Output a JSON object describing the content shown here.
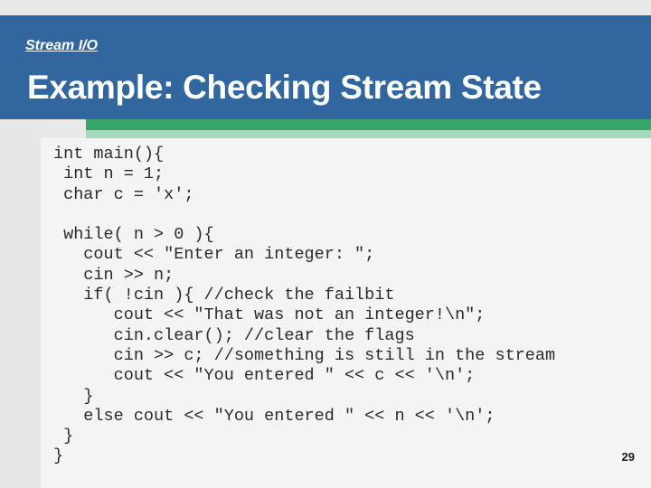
{
  "slide": {
    "kicker": "Stream I/O",
    "title": "Example: Checking Stream State",
    "number": "29",
    "colors": {
      "header_blue": "#31679e",
      "accent_green": "#38a569",
      "accent_green_light": "#a5d9bd",
      "page_background": "#e9e9e9",
      "panel_background": "#f4f4f4",
      "code_text": "#2b2b2b",
      "title_text": "#ffffff"
    }
  },
  "code": {
    "language": "cpp",
    "text": "int main(){\n int n = 1;\n char c = 'x';\n\n while( n > 0 ){\n   cout << \"Enter an integer: \";\n   cin >> n;\n   if( !cin ){ //check the failbit\n      cout << \"That was not an integer!\\n\";\n      cin.clear(); //clear the flags\n      cin >> c; //something is still in the stream\n      cout << \"You entered \" << c << '\\n';\n   }\n   else cout << \"You entered \" << n << '\\n';\n }\n}",
    "lines": [
      "int main(){",
      " int n = 1;",
      " char c = 'x';",
      "",
      " while( n > 0 ){",
      "   cout << \"Enter an integer: \";",
      "   cin >> n;",
      "   if( !cin ){ //check the failbit",
      "      cout << \"That was not an integer!\\n\";",
      "      cin.clear(); //clear the flags",
      "      cin >> c; //something is still in the stream",
      "      cout << \"You entered \" << c << '\\n';",
      "   }",
      "   else cout << \"You entered \" << n << '\\n';",
      " }",
      "}"
    ]
  }
}
